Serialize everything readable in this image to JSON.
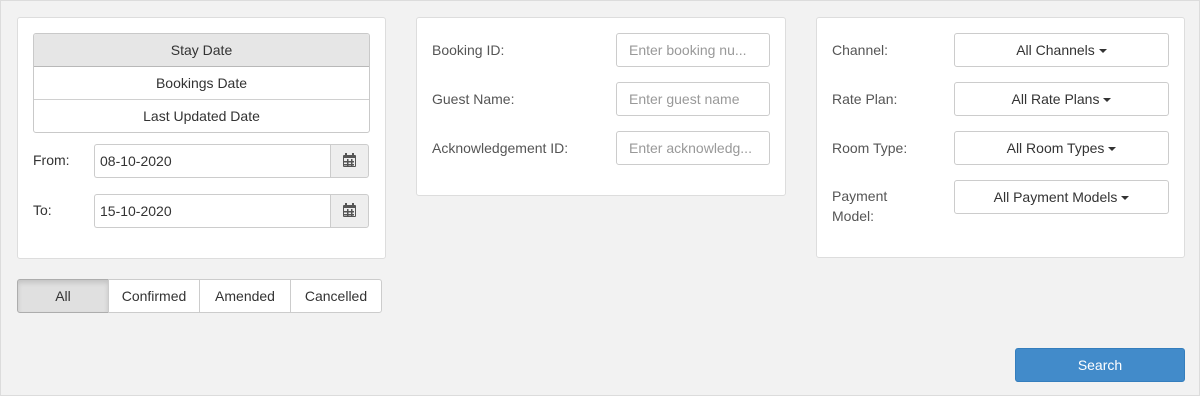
{
  "date_filter": {
    "options": [
      "Stay Date",
      "Bookings Date",
      "Last Updated Date"
    ],
    "selected": "Stay Date",
    "from_label": "From:",
    "from_value": "08-10-2020",
    "to_label": "To:",
    "to_value": "15-10-2020",
    "calendar_icon": "calendar-icon"
  },
  "status_filter": {
    "options": [
      "All",
      "Confirmed",
      "Amended",
      "Cancelled"
    ],
    "selected": "All"
  },
  "search_fields": {
    "booking_id": {
      "label": "Booking ID:",
      "placeholder": "Enter booking nu..."
    },
    "guest_name": {
      "label": "Guest Name:",
      "placeholder": "Enter guest name"
    },
    "acknowledgement_id": {
      "label": "Acknowledgement ID:",
      "placeholder": "Enter acknowledg..."
    }
  },
  "dropdown_filters": {
    "channel": {
      "label": "Channel:",
      "value": "All Channels"
    },
    "rate_plan": {
      "label": "Rate Plan:",
      "value": "All Rate Plans"
    },
    "room_type": {
      "label": "Room Type:",
      "value": "All Room Types"
    },
    "payment_model": {
      "label_line1": "Payment",
      "label_line2": "Model:",
      "value": "All Payment Models"
    }
  },
  "search_button": {
    "label": "Search"
  },
  "colors": {
    "background": "#f2f2f2",
    "primary": "#428bca",
    "active_segment": "#e6e6e6"
  }
}
